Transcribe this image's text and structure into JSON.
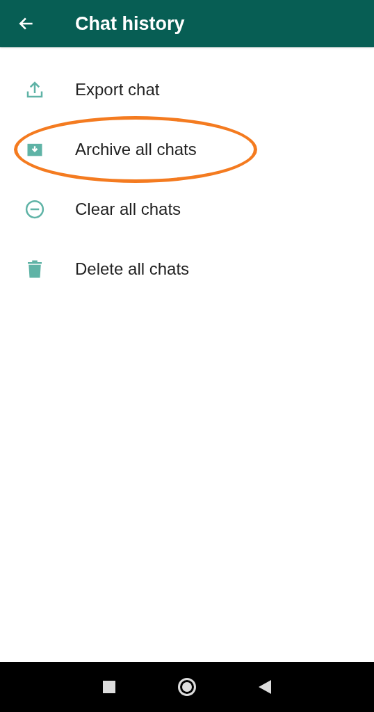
{
  "app_bar": {
    "title": "Chat history"
  },
  "items": [
    {
      "kind": "export",
      "label": "Export chat",
      "highlighted": false
    },
    {
      "kind": "archive",
      "label": "Archive all chats",
      "highlighted": true
    },
    {
      "kind": "clear",
      "label": "Clear all chats",
      "highlighted": false
    },
    {
      "kind": "delete",
      "label": "Delete all chats",
      "highlighted": false
    }
  ]
}
